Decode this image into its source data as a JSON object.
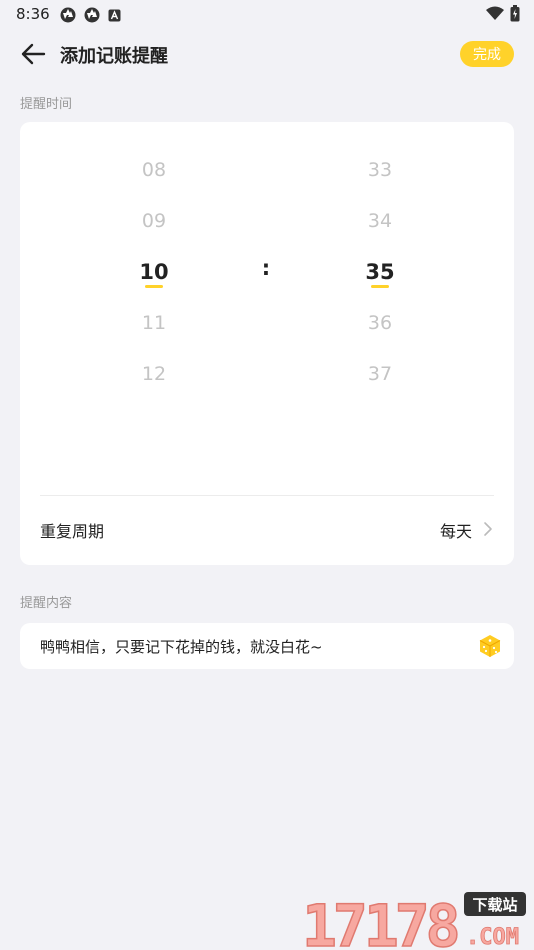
{
  "status": {
    "time": "8:36"
  },
  "header": {
    "title": "添加记账提醒",
    "done_label": "完成"
  },
  "time_section": {
    "label": "提醒时间",
    "hours": [
      "08",
      "09",
      "10",
      "11",
      "12"
    ],
    "minutes": [
      "33",
      "34",
      "35",
      "36",
      "37"
    ],
    "selected_hour": "10",
    "selected_minute": "35",
    "separator": ":",
    "repeat_label": "重复周期",
    "repeat_value": "每天"
  },
  "content_section": {
    "label": "提醒内容",
    "text": "鸭鸭相信，只要记下花掉的钱，就没白花~"
  },
  "watermark": {
    "brand_number": "17178",
    "badge_text": "下载站",
    "suffix": ".COM"
  },
  "colors": {
    "accent": "#ffd22a",
    "background": "#f2f2f6"
  }
}
